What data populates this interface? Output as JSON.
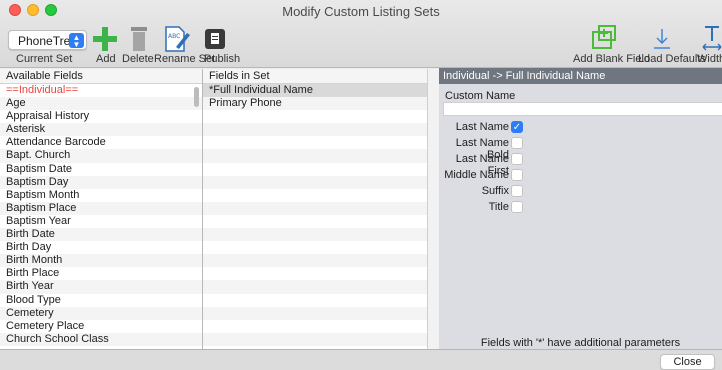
{
  "window": {
    "title": "Modify Custom Listing Sets"
  },
  "toolbar": {
    "current_set_value": "PhoneTree",
    "current_set_label": "Current Set",
    "add_label": "Add",
    "delete_label": "Delete",
    "rename_label": "Rename Set",
    "publish_label": "Publish",
    "add_blank_label": "Add Blank Field",
    "load_defaults_label": "Load Defaults",
    "width_label": "Width"
  },
  "available": {
    "header": "Available Fields",
    "items": [
      "==Individual==",
      "Age",
      "Appraisal History",
      "Asterisk",
      "Attendance Barcode",
      "Bapt. Church",
      "Baptism Date",
      "Baptism Day",
      "Baptism Month",
      "Baptism Place",
      "Baptism Year",
      "Birth Date",
      "Birth Day",
      "Birth Month",
      "Birth Place",
      "Birth Year",
      "Blood Type",
      "Cemetery",
      "Cemetery Place",
      "Church School Class"
    ]
  },
  "in_set": {
    "header": "Fields in Set",
    "items": [
      "*Full Individual Name",
      "Primary Phone"
    ]
  },
  "detail": {
    "header": "Individual -> Full Individual Name",
    "custom_name_label": "Custom Name",
    "custom_name_value": "",
    "options": [
      {
        "label": "Last Name",
        "checked": true
      },
      {
        "label": "Last Name Bold",
        "checked": false
      },
      {
        "label": "Last Name First",
        "checked": false
      },
      {
        "label": "Middle Name",
        "checked": false
      },
      {
        "label": "Suffix",
        "checked": false
      },
      {
        "label": "Title",
        "checked": false
      }
    ],
    "note": "Fields with '*' have additional parameters",
    "checkmark": "✓"
  },
  "footer": {
    "close_label": "Close"
  },
  "colors": {
    "accent": "#2e7cf6",
    "green": "#3cb44a",
    "header_dark": "#6f7680",
    "red_text": "#e8443a"
  }
}
